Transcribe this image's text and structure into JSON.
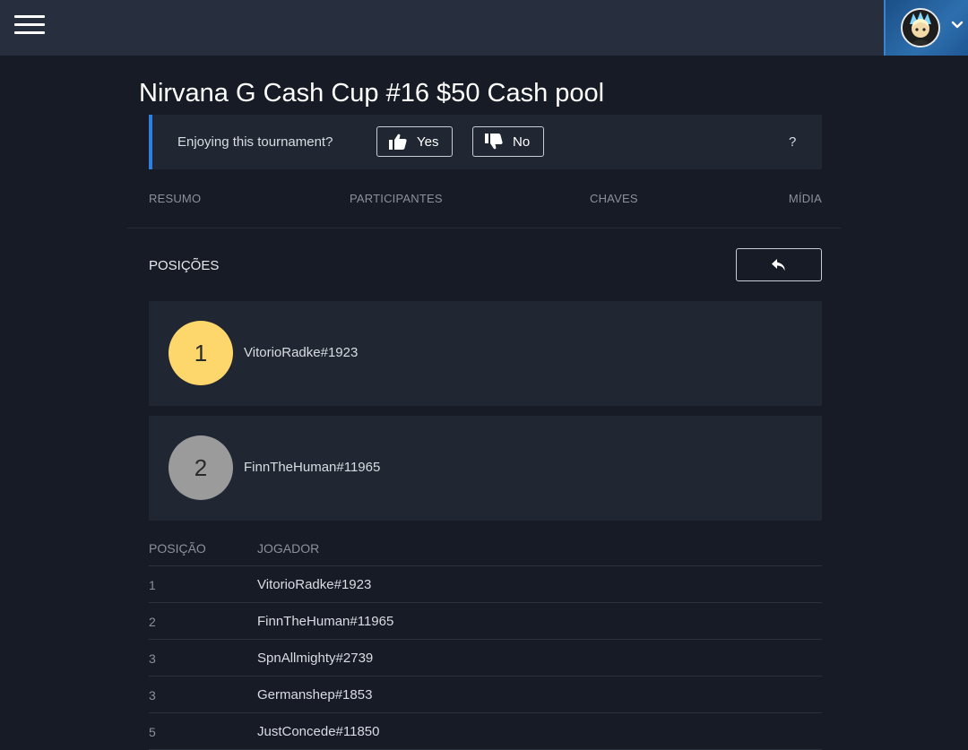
{
  "header": {
    "menu_icon": "hamburger-menu-icon",
    "avatar_icon": "user-avatar",
    "dropdown_icon": "chevron-down-icon"
  },
  "tournament": {
    "title": "Nirvana G Cash Cup #16 $50 Cash pool"
  },
  "feedback": {
    "prompt": "Enjoying this tournament?",
    "yes_label": "Yes",
    "no_label": "No",
    "help_label": "?",
    "accent_color": "#2f7fe0"
  },
  "tabs": [
    {
      "label": "RESUMO"
    },
    {
      "label": "PARTICIPANTES"
    },
    {
      "label": "CHAVES"
    },
    {
      "label": "MÍDIA"
    }
  ],
  "standings": {
    "title": "POSIÇÕES",
    "back_icon": "reply-arrow-icon",
    "podium": [
      {
        "rank": "1",
        "name": "VitorioRadke#1923",
        "color": "#fdd76b"
      },
      {
        "rank": "2",
        "name": "FinnTheHuman#11965",
        "color": "#9b9b9b"
      }
    ],
    "columns": {
      "position": "POSIÇÃO",
      "player": "JOGADOR"
    },
    "rows": [
      {
        "pos": "1",
        "player": "VitorioRadke#1923"
      },
      {
        "pos": "2",
        "player": "FinnTheHuman#11965"
      },
      {
        "pos": "3",
        "player": "SpnAllmighty#2739"
      },
      {
        "pos": "3",
        "player": "Germanshep#1853"
      },
      {
        "pos": "5",
        "player": "JustConcede#11850"
      }
    ]
  }
}
